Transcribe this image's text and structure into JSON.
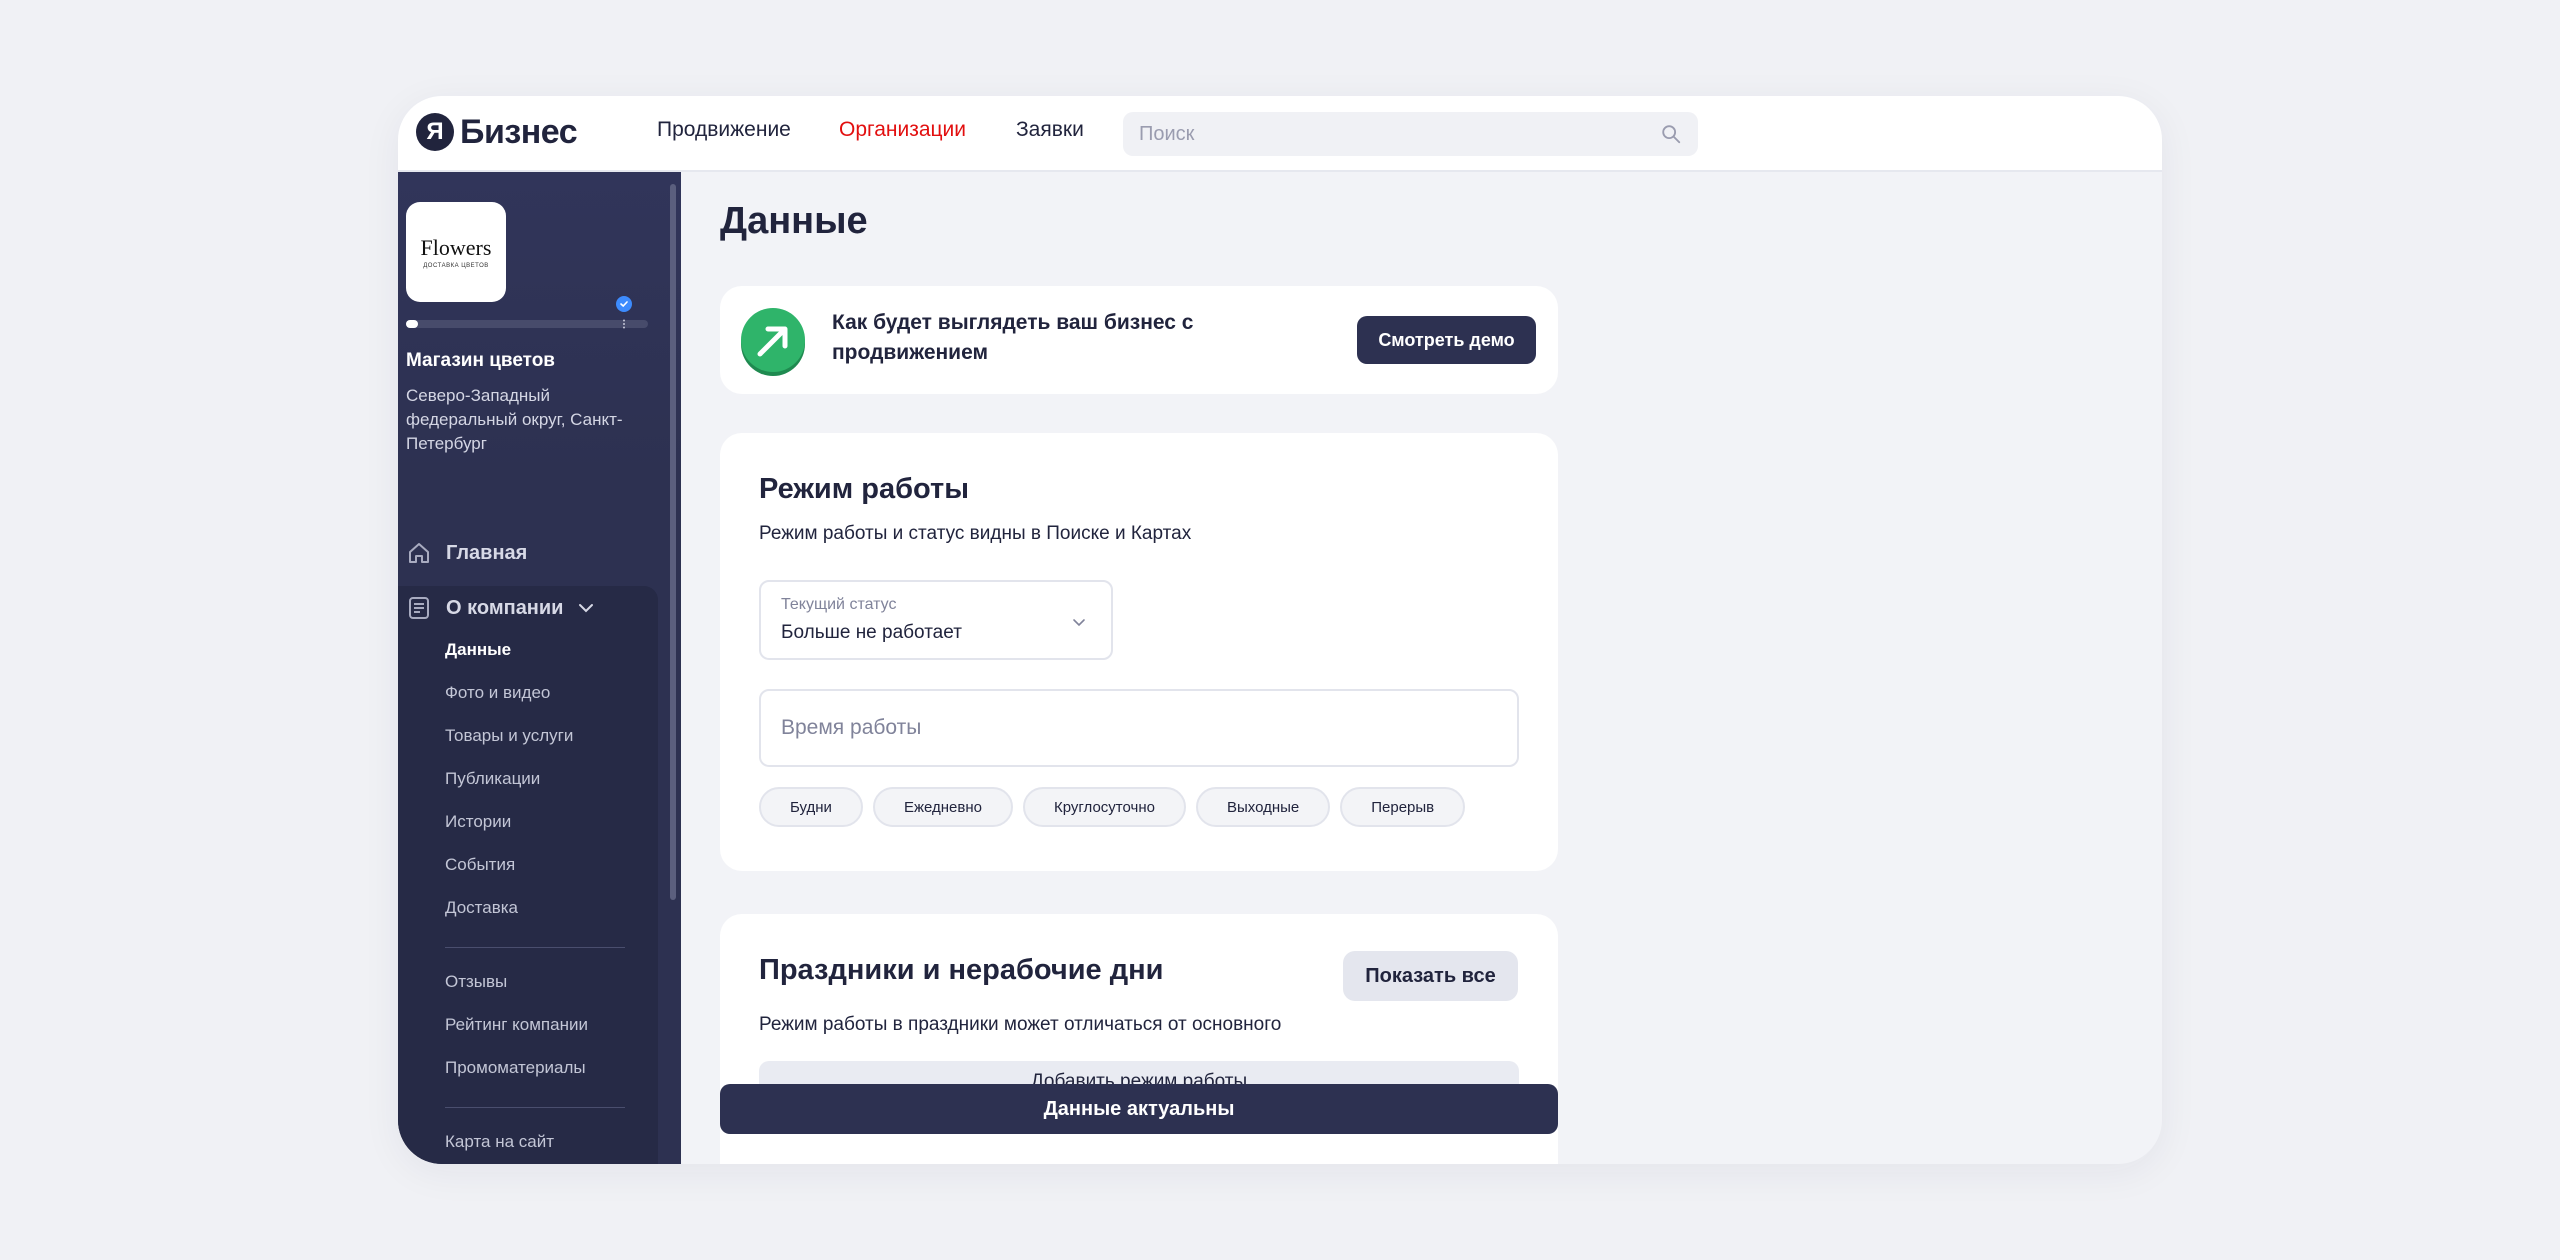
{
  "header": {
    "logo_mark": "Я",
    "logo_text": "Бизнес",
    "nav": [
      "Продвижение",
      "Организации",
      "Заявки"
    ],
    "active_nav": "Организации",
    "search_placeholder": "Поиск"
  },
  "sidebar": {
    "business_logo_title": "Flowers",
    "business_logo_subtitle": "ДОСТАВКА ЦВЕТОВ",
    "profile_progress": 0.05,
    "business_name": "Магазин цветов",
    "business_address": "Северо-Западный федеральный округ, Санкт-Петербург",
    "main_item": "Главная",
    "group_label": "О компании",
    "group_items": [
      "Данные",
      "Фото и видео",
      "Товары и услуги",
      "Публикации",
      "Истории",
      "События",
      "Доставка"
    ],
    "active_item": "Данные",
    "secondary_items": [
      "Отзывы",
      "Рейтинг компании",
      "Промоматериалы"
    ],
    "tertiary_items": [
      "Карта на сайт"
    ]
  },
  "main": {
    "page_title": "Данные",
    "promo": {
      "text": "Как будет выглядеть ваш бизнес с продвижением",
      "button": "Смотреть демо"
    },
    "schedule": {
      "title": "Режим работы",
      "description": "Режим работы и статус видны в Поиске и Картах",
      "status_label": "Текущий статус",
      "status_value": "Больше не работает",
      "hours_placeholder": "Время работы",
      "chips": [
        "Будни",
        "Ежедневно",
        "Круглосуточно",
        "Выходные",
        "Перерыв"
      ]
    },
    "holidays": {
      "title": "Праздники и нерабочие дни",
      "show_all": "Показать все",
      "description": "Режим работы в праздники может отличаться от основного",
      "add_button": "Добавить режим работы"
    },
    "actual_button": "Данные актуальны"
  },
  "colors": {
    "accent_red": "#e20f0f",
    "sidebar_bg": "#2d3151",
    "dark_button": "#2d3151",
    "promo_green": "#2fb46a"
  }
}
